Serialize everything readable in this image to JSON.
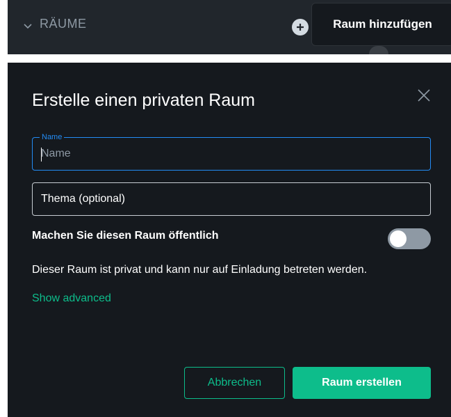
{
  "sidebar": {
    "section_title": "RÄUME",
    "add_room_tooltip": "Raum hinzufügen",
    "icons": {
      "toggle": "chevron-down-icon",
      "add": "plus-icon"
    }
  },
  "dialog": {
    "title": "Erstelle einen privaten Raum",
    "name_field": {
      "label": "Name",
      "placeholder": "Name",
      "value": ""
    },
    "topic_field": {
      "placeholder": "Thema (optional)",
      "value": ""
    },
    "public_toggle": {
      "label": "Machen Sie diesen Raum öffentlich",
      "enabled": false
    },
    "info_text": "Dieser Raum ist privat und kann nur auf Einladung betreten werden.",
    "show_advanced": "Show advanced",
    "cancel_label": "Abbrechen",
    "create_label": "Raum erstellen"
  },
  "colors": {
    "accent": "#0dbd8b",
    "focus": "#238cf5",
    "dialog_bg": "#15191e",
    "sidebar_bg": "#21262c"
  }
}
